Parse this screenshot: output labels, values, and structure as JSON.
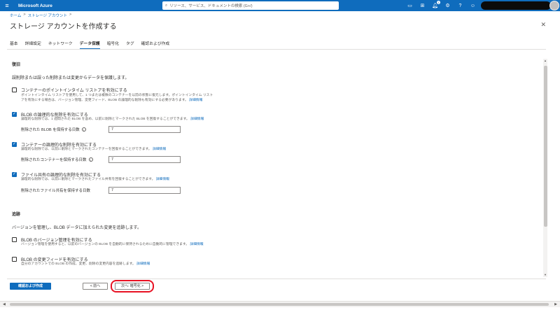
{
  "topbar": {
    "menu_icon": "hamburger-icon",
    "brand": "Microsoft Azure",
    "search_placeholder": "リソース、サービス、ドキュメントの検索 (G+/)",
    "icons": [
      "cloud-shell-icon",
      "directory-filter-icon",
      "notifications-icon",
      "settings-icon",
      "help-icon",
      "feedback-icon"
    ],
    "notification_count": "1",
    "accent_color": "#0f6cbd"
  },
  "breadcrumb": {
    "home": "ホーム",
    "sep": ">",
    "current": "ストレージ アカウント"
  },
  "page": {
    "title": "ストレージ アカウントを作成する",
    "close": "✕"
  },
  "tabs": [
    {
      "label": "基本",
      "active": false
    },
    {
      "label": "詳細設定",
      "active": false
    },
    {
      "label": "ネットワーク",
      "active": false
    },
    {
      "label": "データ保護",
      "active": true
    },
    {
      "label": "暗号化",
      "active": false
    },
    {
      "label": "タグ",
      "active": false
    },
    {
      "label": "確認および作成",
      "active": false
    }
  ],
  "recovery": {
    "heading": "復旧",
    "description": "誤削除または誤った削除または変更からデータを保護します。",
    "items": [
      {
        "label": "コンテナーのポイントインタイム リストアを有効にする",
        "checked": false,
        "desc1": "ポイントインタイム リストアを使用して、1 つまたは複数のコンテナーを以前の状態に復元します。ポイントインタイム リスト",
        "desc2": "アを有効にする場合は、バージョン管理、変更フィード、BLOB の論理的な削除も有効にする必要があります。",
        "link": "詳細情報"
      },
      {
        "label": "BLOB の論理的な削除を有効にする",
        "checked": true,
        "desc1": "論理的な削除では、1 週間された BLOB を含め、以前に削除とマークされた BLOB を回復することができます。",
        "link": "詳細情報",
        "field_label": "削除された BLOB を保持する日数",
        "field_value": "7"
      },
      {
        "label": "コンテナーの論理的な削除を有効にする",
        "checked": true,
        "desc1": "論理的な削除では、以前に削除とマークされたコンテナーを回復することができます。",
        "link": "詳細情報",
        "field_label": "削除されたコンテナーを保持する日数",
        "field_value": "7"
      },
      {
        "label": "ファイル共有の論理的な削除を有効にする",
        "checked": true,
        "desc1": "論理的な削除では、以前に削除とマークされたファイル共有を回復することができます。",
        "link": "詳細情報",
        "field_label": "削除されたファイル共有を保持する日数",
        "field_value": "7"
      }
    ]
  },
  "tracking": {
    "heading": "追跡",
    "description": "バージョンを管理し、BLOB データに加えられた変更を追跡します。",
    "items": [
      {
        "label": "BLOB のバージョン管理を有効にする",
        "checked": false,
        "desc1": "バージョン管理を使用すると、以前のバージョンの BLOB を自動的に保持されるために自動的に管理できます。",
        "link": "詳細情報"
      },
      {
        "label": "BLOB の変更フィードを有効にする",
        "checked": false,
        "desc1": "自分のアカウントでの BLOB の作成、変更、削除の変更内容を追跡します。",
        "link": "詳細情報"
      }
    ]
  },
  "footer": {
    "review_create": "確認および作成",
    "prev": "< 前へ",
    "next": "次へ: 暗号化 >"
  },
  "info_glyph": "i",
  "check_glyph": "✓"
}
